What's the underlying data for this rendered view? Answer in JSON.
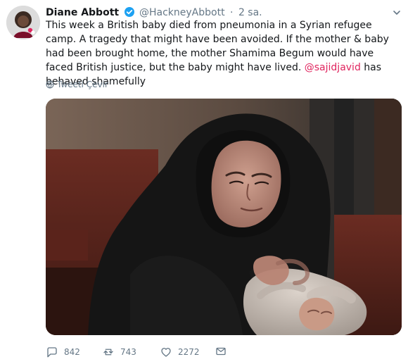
{
  "tweet": {
    "author_name": "Diane Abbott",
    "handle": "@HackneyAbbott",
    "separator": "·",
    "time": "2 sa.",
    "text_before": "This week a British baby died from pneumonia in a Syrian refugee camp. A tragedy that might have been avoided. If the mother & baby had been brought home, the mother Shamima Begum would have faced British justice, but the baby might have lived. ",
    "mention": "@sajidjavid",
    "text_after": " has behaved shamefully",
    "translate_label": "Tweeti Çevir",
    "icons": {
      "avatar": "avatar-image",
      "verified": "verified-badge-icon",
      "caret": "chevron-down-icon",
      "translate": "globe-icon",
      "reply": "reply-icon",
      "retweet": "retweet-icon",
      "like": "heart-icon",
      "message": "envelope-icon"
    }
  },
  "actions": {
    "reply_count": "842",
    "retweet_count": "743",
    "like_count": "2272"
  },
  "colors": {
    "text": "#14171a",
    "muted": "#657786",
    "mention": "#e0245e",
    "verified": "#1da1f2"
  }
}
